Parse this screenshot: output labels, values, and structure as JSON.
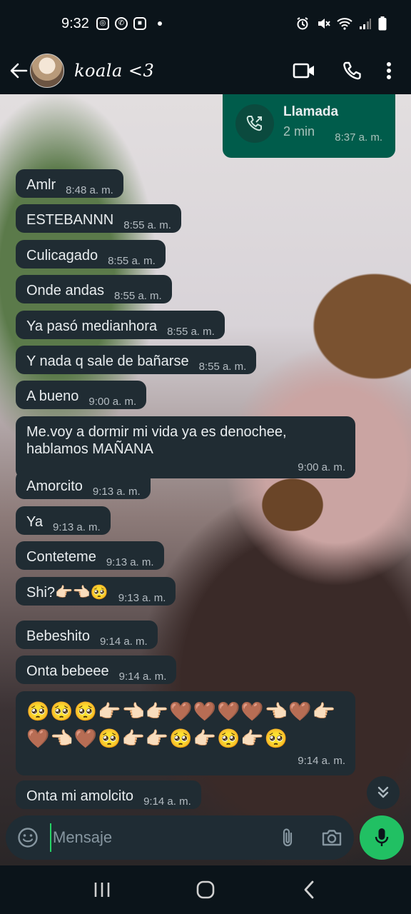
{
  "status_bar": {
    "time": "9:32"
  },
  "header": {
    "contact_name": "฿฿koala฿฿ <3",
    "contact_display": "koala <3"
  },
  "call": {
    "title": "Llamada",
    "duration": "2 min",
    "time": "8:37 a. m."
  },
  "messages": [
    {
      "text": "Amlr",
      "time": "8:48 a. m."
    },
    {
      "text": "ESTEBANNN",
      "time": "8:55 a. m."
    },
    {
      "text": "Culicagado",
      "time": "8:55 a. m."
    },
    {
      "text": "Onde andas",
      "time": "8:55 a. m."
    },
    {
      "text": "Ya pasó medianhora",
      "time": "8:55 a. m."
    },
    {
      "text": "Y nada q sale de bañarse",
      "time": "8:55 a. m."
    },
    {
      "text": "A bueno",
      "time": "9:00 a. m."
    },
    {
      "text": "Me.voy a dormir mi vida ya es denochee, hablamos MAÑANA",
      "time": "9:00 a. m."
    },
    {
      "text": "Amorcito",
      "time": "9:13 a. m."
    },
    {
      "text": "Ya",
      "time": "9:13 a. m."
    },
    {
      "text": "Conteteme",
      "time": "9:13 a. m."
    },
    {
      "text": "Shi?👉🏻👈🏻🥺",
      "time": "9:13 a. m."
    },
    {
      "text": "Bebeshito",
      "time": "9:14 a. m."
    },
    {
      "text": "Onta bebeee",
      "time": "9:14 a. m."
    },
    {
      "text": "🥺🥺🥺👉🏻👈🏻👉🏻🤎🤎🤎🤎👈🏻🤎👉🏻 🤎👈🏻🤎🥺👉🏻👉🏻🥺👉🏻🥺👉🏻🥺",
      "time": "9:14 a. m."
    },
    {
      "text": "Onta mi amolcito",
      "time": "9:14 a. m."
    }
  ],
  "composer": {
    "placeholder": "Mensaje"
  },
  "icons": {
    "back": "arrow-left",
    "video": "video-camera",
    "voice": "phone",
    "more": "three-dots",
    "emoji": "smiley",
    "attach": "paperclip",
    "camera": "camera",
    "mic": "microphone",
    "scroll": "double-chevron-down"
  },
  "colors": {
    "app_bg": "#0b141a",
    "incoming_bubble": "#202c33",
    "outgoing_bubble": "#005c4b",
    "accent": "#21c063"
  }
}
